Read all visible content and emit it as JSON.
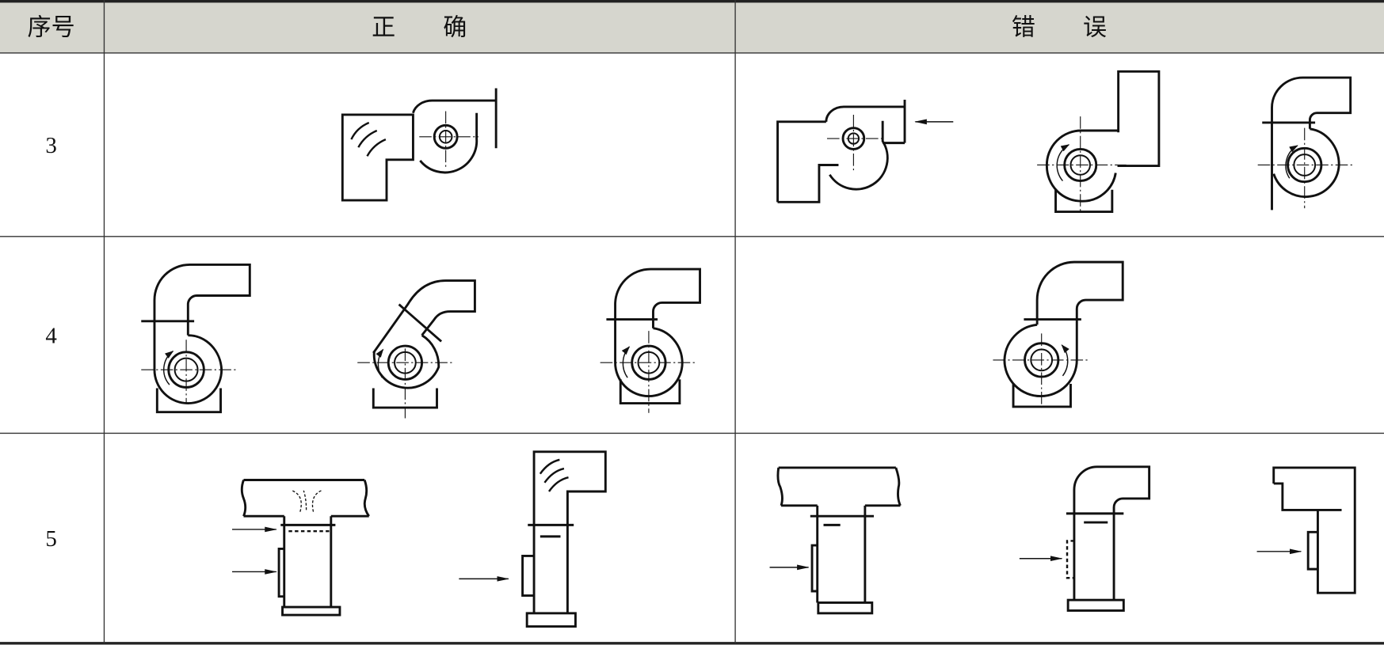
{
  "table": {
    "header": {
      "index_label": "序号",
      "correct_label": "正　　确",
      "wrong_label": "错　　误"
    },
    "rows": [
      {
        "number": "3"
      },
      {
        "number": "4"
      },
      {
        "number": "5"
      }
    ]
  },
  "colors": {
    "header_background": "#d6d6ce",
    "line": "#111111"
  }
}
